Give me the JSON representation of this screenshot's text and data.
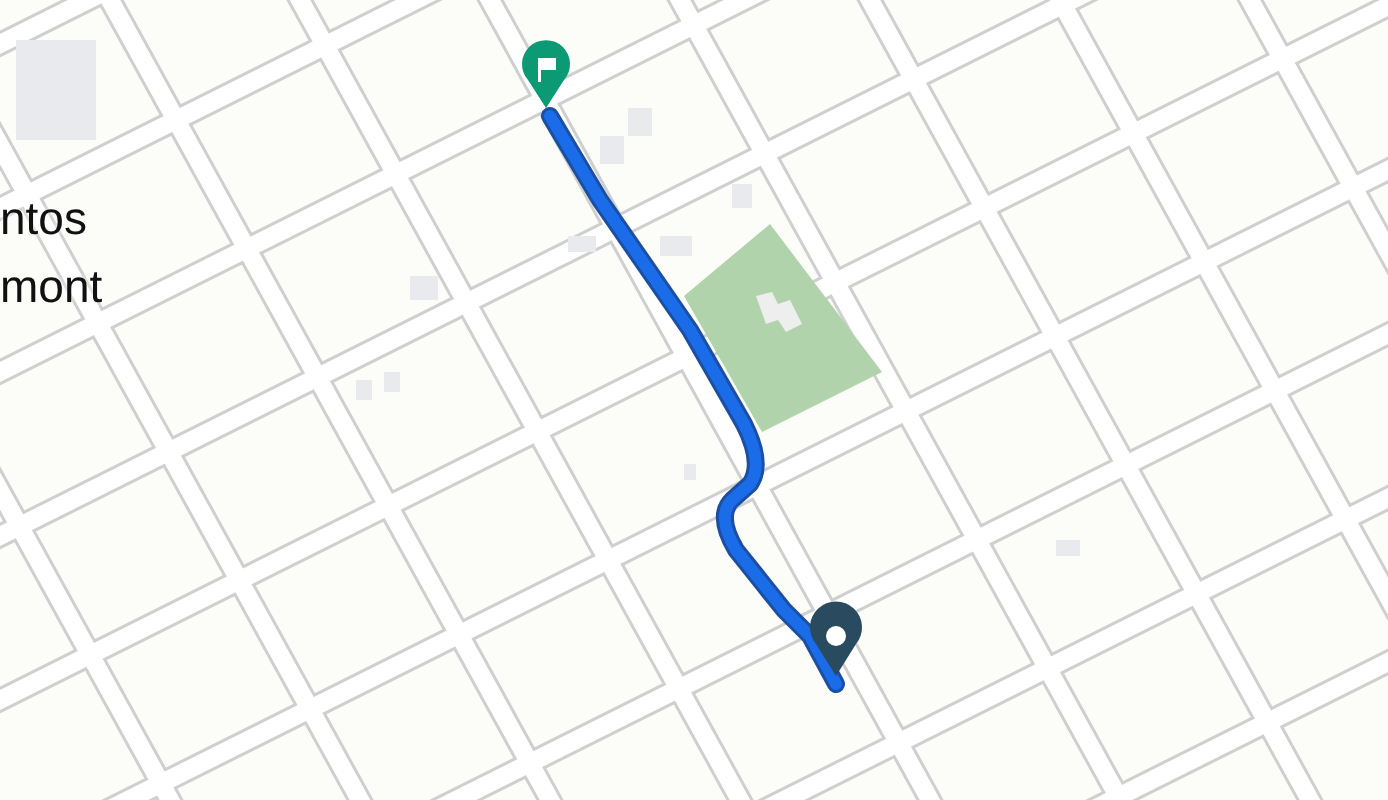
{
  "map": {
    "place_label": [
      "ntos",
      "mont"
    ]
  }
}
